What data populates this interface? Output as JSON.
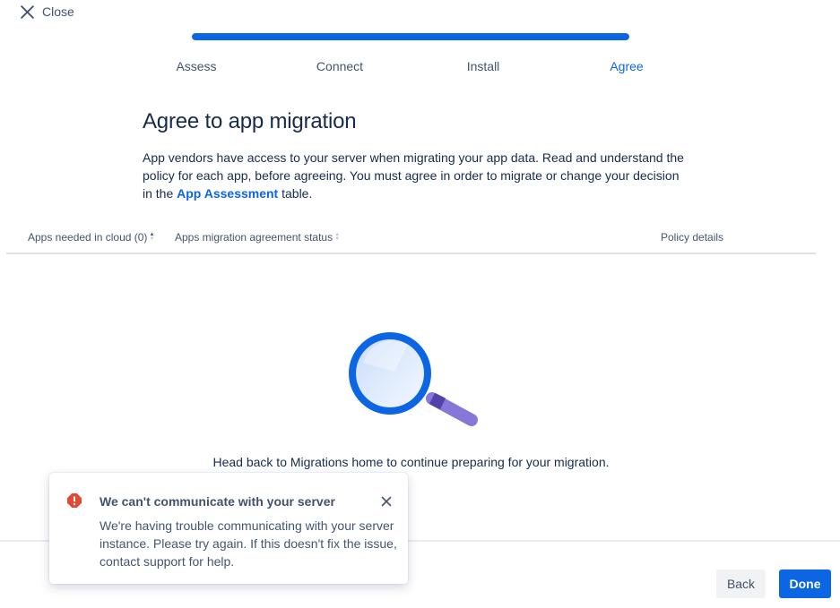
{
  "header": {
    "close_label": "Close"
  },
  "progress": {
    "value_fraction": 1.0,
    "steps": [
      {
        "label": "Assess",
        "active": false
      },
      {
        "label": "Connect",
        "active": false
      },
      {
        "label": "Install",
        "active": false
      },
      {
        "label": "Agree",
        "active": true
      }
    ]
  },
  "main": {
    "title": "Agree to app migration",
    "description_part1": "App vendors have access to your server when migrating your app data. Read and understand the policy for each app, before agreeing. You must agree in order to migrate or change your decision in the ",
    "description_link": "App Assessment",
    "description_part2": " table."
  },
  "table": {
    "columns": [
      {
        "label": "Apps needed in cloud (0)",
        "sort": "ascending"
      },
      {
        "label": "Apps migration agreement status",
        "sort": "none"
      },
      {
        "label": "Policy details",
        "sort": ""
      }
    ]
  },
  "empty_state": {
    "icon": "magnifying-glass-illustration",
    "text": "Head back to Migrations home to continue preparing for your migration."
  },
  "flag": {
    "icon": "error-icon",
    "title": "We can't communicate with your server",
    "body": "We're having trouble communicating with your server instance. Please try again. If this doesn't fix the issue, contact support for help."
  },
  "footer": {
    "back_label": "Back",
    "done_label": "Done"
  },
  "colors": {
    "primary": "#0c66e4",
    "error": "#e34935",
    "text": "#172b4d"
  }
}
